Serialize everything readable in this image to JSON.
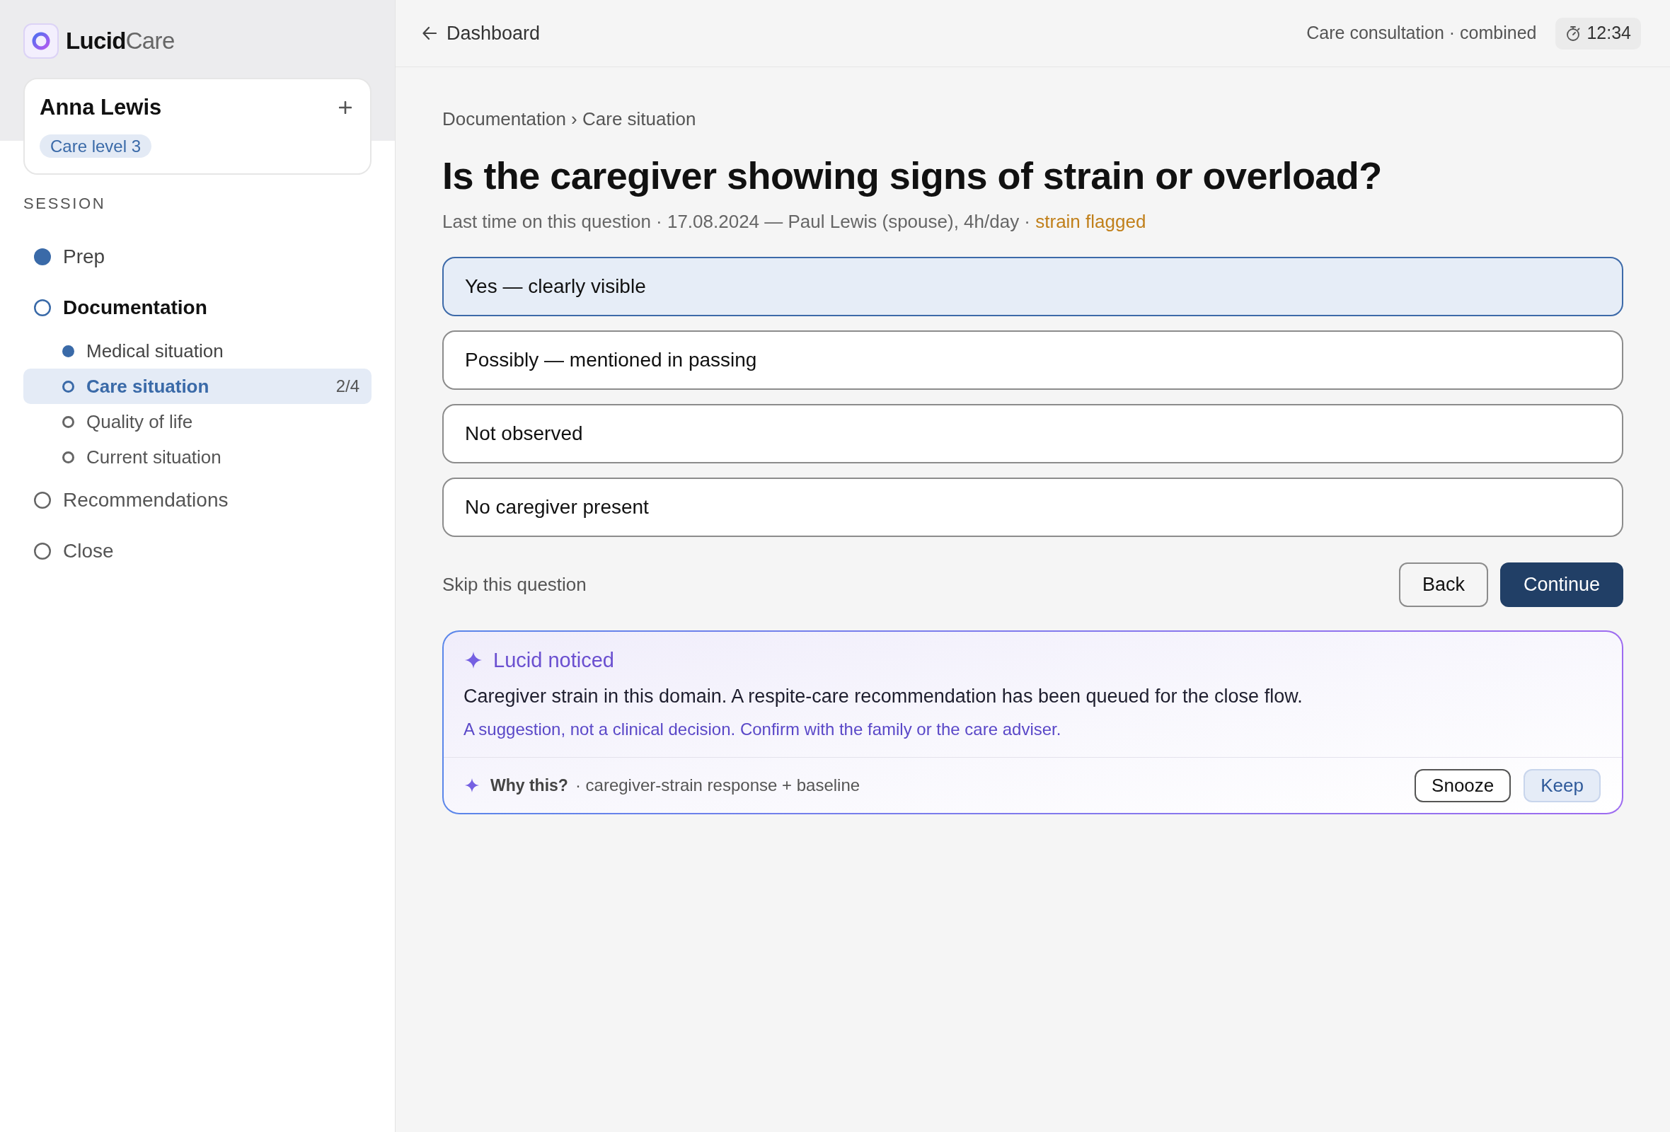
{
  "brand": {
    "name": "Lucid",
    "suffix": "Care"
  },
  "patient": {
    "name": "Anna Lewis",
    "care_level": "Care level 3"
  },
  "session": {
    "heading": "SESSION",
    "steps": [
      {
        "label": "Prep",
        "done": true,
        "current": false,
        "selected": false
      },
      {
        "label": "Documentation",
        "done": false,
        "current": true,
        "selected": false,
        "children": [
          {
            "label": "Medical situation",
            "done": true,
            "current": false,
            "selected": false
          },
          {
            "label": "Care situation",
            "done": false,
            "current": true,
            "selected": true,
            "count": "2/4"
          },
          {
            "label": "Quality of life",
            "done": false,
            "current": false,
            "selected": false
          },
          {
            "label": "Current situation",
            "done": false,
            "current": false,
            "selected": false
          }
        ]
      },
      {
        "label": "Recommendations",
        "done": false,
        "current": false,
        "selected": false
      },
      {
        "label": "Close",
        "done": false,
        "current": false,
        "selected": false
      }
    ]
  },
  "header": {
    "back_link": "Dashboard",
    "context": "Care consultation · combined",
    "timer": "12:34"
  },
  "question": {
    "breadcrumb": "Documentation › Care situation",
    "title": "Is the caregiver showing signs of strain or overload?",
    "history": "Last time on this question · 17.08.2024 — Paul Lewis (spouse), 4h/day ·",
    "flag": "strain flagged",
    "options": [
      {
        "label": "Yes — clearly visible",
        "selected": true
      },
      {
        "label": "Possibly — mentioned in passing",
        "selected": false
      },
      {
        "label": "Not observed",
        "selected": false
      },
      {
        "label": "No caregiver present",
        "selected": false
      }
    ],
    "skip": "Skip this question",
    "buttons": [
      {
        "label": "Back",
        "kind": "secondary"
      },
      {
        "label": "Continue",
        "kind": "primary"
      }
    ]
  },
  "insight": {
    "title": "Lucid noticed",
    "message": "Caregiver strain in this domain. A respite-care recommendation has been queued for the close flow.",
    "disclaimer": "A suggestion, not a clinical decision. Confirm with the family or the care adviser.",
    "why_label": "Why this?",
    "why_detail": "· caregiver-strain response + baseline",
    "buttons": [
      {
        "label": "Snooze",
        "kind": "secondary"
      },
      {
        "label": "Keep",
        "kind": "primary"
      }
    ]
  }
}
